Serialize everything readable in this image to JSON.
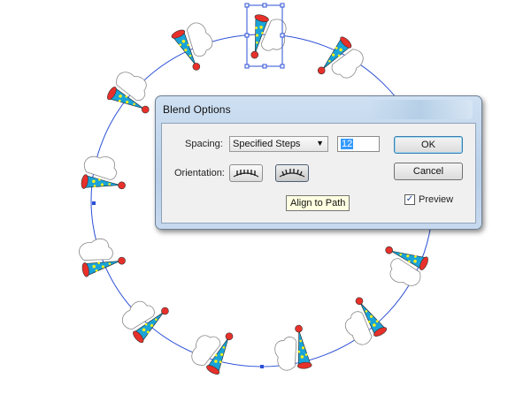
{
  "dialog": {
    "title": "Blend Options",
    "spacing_label": "Spacing:",
    "spacing_value": "Specified Steps",
    "steps_value": "12",
    "orientation_label": "Orientation:",
    "ok_label": "OK",
    "cancel_label": "Cancel",
    "preview_label": "Preview",
    "preview_checked": "✓",
    "tooltip": "Align to Path"
  },
  "colors": {
    "path": "#2b4fd6",
    "hat_body": "#1aa3d8",
    "hat_rim": "#e8302a",
    "hat_dots": "#f4ef1b",
    "pompom": "#e8302a",
    "hair": "#ffffff"
  },
  "icons": [
    "align-to-page-icon",
    "align-to-path-icon",
    "dropdown-arrow-icon",
    "checkmark-icon"
  ]
}
